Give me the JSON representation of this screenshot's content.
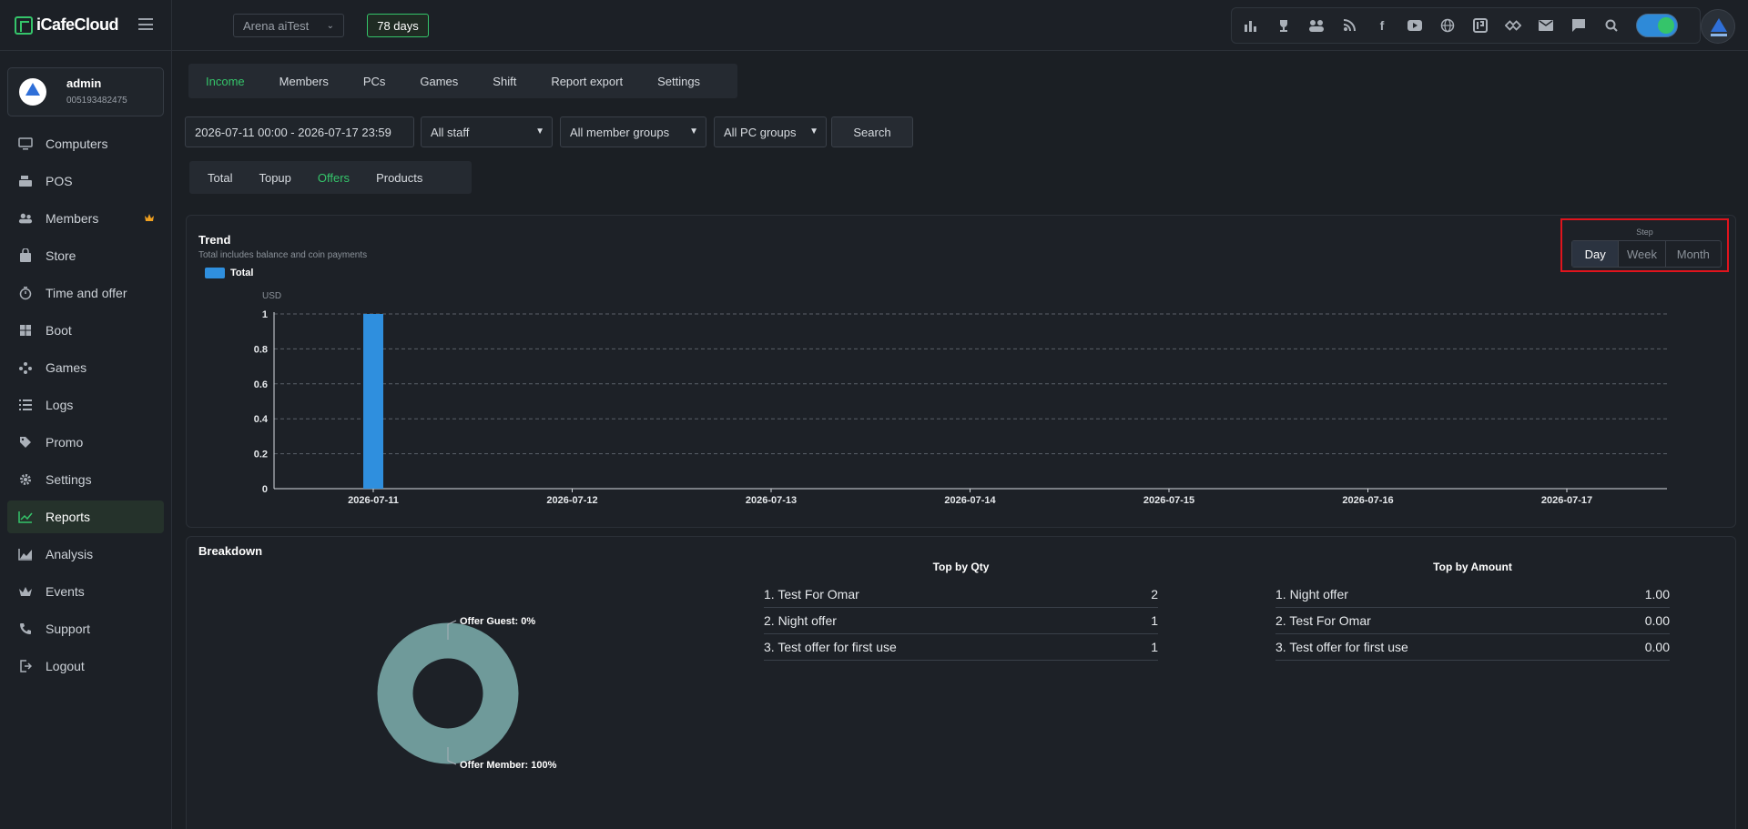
{
  "app": {
    "logo_text": "iCafeCloud"
  },
  "topbar": {
    "cafe_name": "Arena aiTest",
    "days_badge": "78 days",
    "icons": [
      "chart-bars-icon",
      "trophy-icon",
      "users-group-icon",
      "rss-icon",
      "facebook-icon",
      "youtube-icon",
      "globe-icon",
      "app-logo-icon",
      "handshake-icon",
      "mail-icon",
      "chat-icon",
      "search-icon"
    ]
  },
  "user": {
    "name": "admin",
    "id": "005193482475"
  },
  "sidebar": {
    "items": [
      {
        "label": "Computers",
        "icon": "monitor-icon"
      },
      {
        "label": "POS",
        "icon": "cash-register-icon"
      },
      {
        "label": "Members",
        "icon": "users-icon",
        "badge": "crown"
      },
      {
        "label": "Store",
        "icon": "bag-icon"
      },
      {
        "label": "Time and offer",
        "icon": "stopwatch-icon"
      },
      {
        "label": "Boot",
        "icon": "windows-icon"
      },
      {
        "label": "Games",
        "icon": "gamepad-icon"
      },
      {
        "label": "Logs",
        "icon": "list-icon"
      },
      {
        "label": "Promo",
        "icon": "tag-icon"
      },
      {
        "label": "Settings",
        "icon": "gear-icon"
      },
      {
        "label": "Reports",
        "icon": "line-chart-icon",
        "active": true
      },
      {
        "label": "Analysis",
        "icon": "area-chart-icon"
      },
      {
        "label": "Events",
        "icon": "crown-icon"
      },
      {
        "label": "Support",
        "icon": "phone-icon"
      },
      {
        "label": "Logout",
        "icon": "logout-icon"
      }
    ]
  },
  "main_tabs": [
    "Income",
    "Members",
    "PCs",
    "Games",
    "Shift",
    "Report export",
    "Settings"
  ],
  "main_tab_active": "Income",
  "filters": {
    "date_range": "2026-07-11 00:00 - 2026-07-17 23:59",
    "staff": "All staff",
    "member_groups": "All member groups",
    "pc_groups": "All PC groups",
    "search_label": "Search"
  },
  "sub_tabs": [
    "Total",
    "Topup",
    "Offers",
    "Products"
  ],
  "sub_tab_active": "Offers",
  "trend": {
    "title": "Trend",
    "subtitle": "Total includes balance and coin payments",
    "step_label": "Step",
    "steps": [
      "Day",
      "Week",
      "Month"
    ],
    "step_active": "Day"
  },
  "chart_data": {
    "type": "bar",
    "title": "Trend",
    "ylabel": "USD",
    "ylim": [
      0,
      1
    ],
    "yticks": [
      "0",
      "0.2",
      "0.4",
      "0.6",
      "0.8",
      "1"
    ],
    "categories": [
      "2026-07-11",
      "2026-07-12",
      "2026-07-13",
      "2026-07-14",
      "2026-07-15",
      "2026-07-16",
      "2026-07-17"
    ],
    "series": [
      {
        "name": "Total",
        "values": [
          1,
          0,
          0,
          0,
          0,
          0,
          0
        ],
        "color": "#2f8fde"
      }
    ],
    "grid": true,
    "legend": "top-left"
  },
  "breakdown": {
    "title": "Breakdown",
    "pie": {
      "type": "pie",
      "slices": [
        {
          "label": "Offer Guest: 0%",
          "value": 0
        },
        {
          "label": "Offer Member: 100%",
          "value": 100,
          "color": "#6f9a9a"
        }
      ]
    },
    "top_by_qty": {
      "title": "Top by Qty",
      "rows": [
        {
          "name": "1. Test For Omar",
          "value": "2"
        },
        {
          "name": "2. Night offer",
          "value": "1"
        },
        {
          "name": "3. Test offer for first use",
          "value": "1"
        }
      ]
    },
    "top_by_amount": {
      "title": "Top by Amount",
      "rows": [
        {
          "name": "1. Night offer",
          "value": "1.00"
        },
        {
          "name": "2. Test For Omar",
          "value": "0.00"
        },
        {
          "name": "3. Test offer for first use",
          "value": "0.00"
        }
      ]
    }
  }
}
